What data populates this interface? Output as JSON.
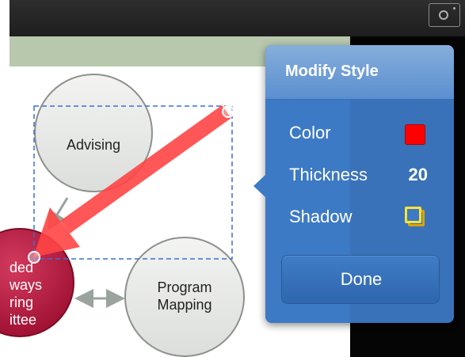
{
  "diagram": {
    "nodes": [
      {
        "id": "advising",
        "label": "Advising"
      },
      {
        "id": "program-mapping",
        "label": "Program\nMapping"
      },
      {
        "id": "guided-pathways",
        "label": "ded\nways\nring\nittee"
      }
    ]
  },
  "annotation": {
    "arrow_color": "#ff4040",
    "arrow_thickness": 20,
    "shadow": true
  },
  "popover": {
    "title": "Modify Style",
    "color_label": "Color",
    "color_value": "#ff0000",
    "thickness_label": "Thickness",
    "thickness_value": "20",
    "shadow_label": "Shadow",
    "done_label": "Done"
  },
  "toolbar": {
    "camera_icon": "camera-icon"
  },
  "colors": {
    "popover_blue": "#3d7ac5",
    "slide_header": "#b8c8ad",
    "node_red": "#b5123b"
  }
}
